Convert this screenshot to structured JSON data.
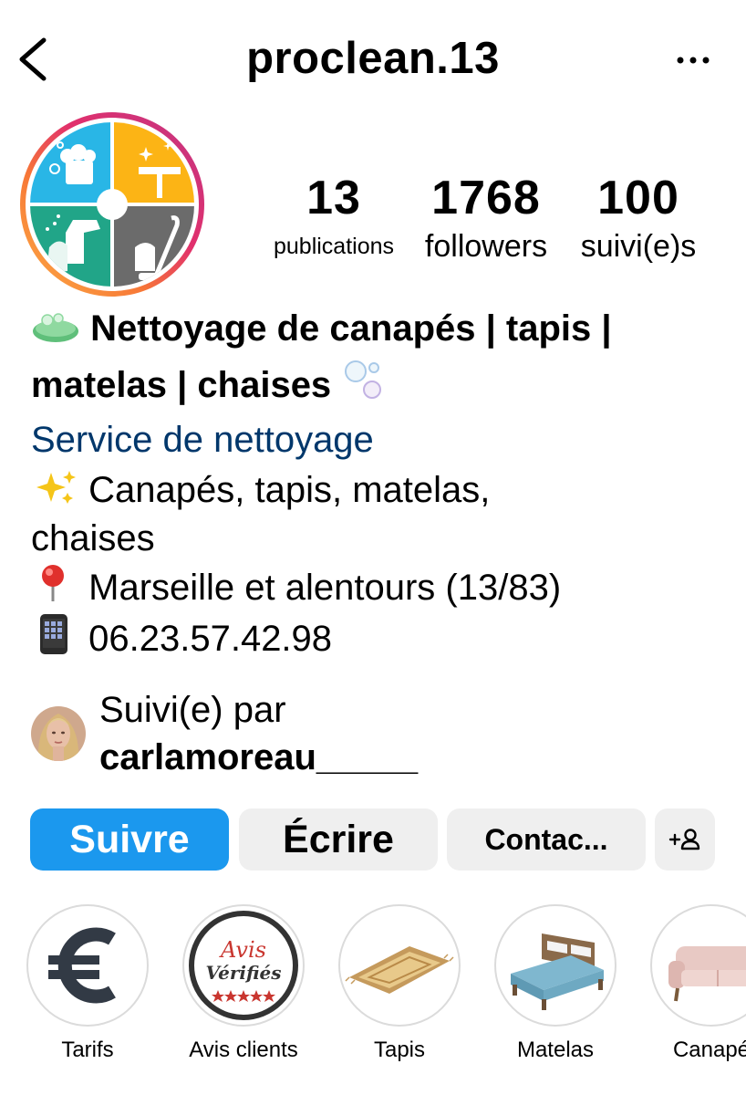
{
  "header": {
    "username": "proclean.13"
  },
  "stats": {
    "posts_count": "13",
    "posts_label": "publications",
    "followers_count": "1768",
    "followers_label": "followers",
    "following_count": "100",
    "following_label": "suivi(e)s"
  },
  "bio": {
    "name_line1": "Nettoyage de canapés | tapis |",
    "name_line2": "matelas | chaises",
    "category": "Service de nettoyage",
    "line1": "Canapés, tapis, matelas,",
    "line2": "chaises",
    "line3": "Marseille et alentours (13/83)",
    "line4": "06.23.57.42.98"
  },
  "followed_by": {
    "label": "Suivi(e) par",
    "username": "carlamoreau_____"
  },
  "actions": {
    "follow": "Suivre",
    "message": "Écrire",
    "contact": "Contac..."
  },
  "highlights": [
    {
      "label": "Tarifs",
      "icon": "euro-icon"
    },
    {
      "label": "Avis clients",
      "icon": "avis-verifies-badge",
      "badge_line1": "Avis",
      "badge_line2": "Vérifiés"
    },
    {
      "label": "Tapis",
      "icon": "rug-icon"
    },
    {
      "label": "Matelas",
      "icon": "bed-icon"
    },
    {
      "label": "Canapé",
      "icon": "sofa-icon"
    }
  ],
  "colors": {
    "follow_button": "#1b98ee",
    "category_link": "#00376b",
    "secondary_button": "#efefef",
    "logo_blue": "#29b6e6",
    "logo_orange": "#fcb415",
    "logo_green": "#21a588",
    "logo_gray": "#6b6b6b"
  }
}
